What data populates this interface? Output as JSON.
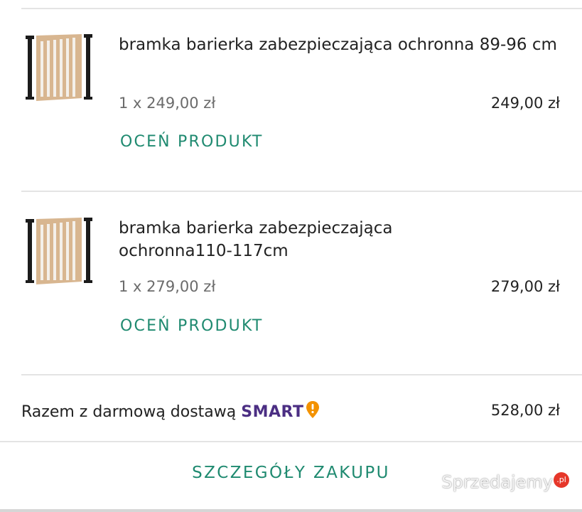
{
  "items": [
    {
      "title": "bramka barierka zabezpieczająca ochronna 89-96 cm",
      "quantity_price": "1 x 249,00 zł",
      "total": "249,00 zł",
      "rate_label": "OCEŃ PRODUKT",
      "image_icon": "baby-gate-image"
    },
    {
      "title": "bramka barierka zabezpieczająca ochronna110-117cm",
      "quantity_price": "1 x 279,00 zł",
      "total": "279,00 zł",
      "rate_label": "OCEŃ PRODUKT",
      "image_icon": "baby-gate-image"
    }
  ],
  "summary": {
    "label": "Razem z darmową dostawą",
    "smart_brand": "SMART",
    "smart_icon": "smart-exclamation-icon",
    "total": "528,00 zł"
  },
  "details_button": "SZCZEGÓŁY ZAKUPU",
  "watermark": {
    "text": "Sprzedajemy",
    "suffix": ".pl"
  },
  "colors": {
    "accent_green": "#1f8a70",
    "smart_purple": "#4b2e83",
    "smart_orange": "#f39200",
    "watermark_red": "#e6372a"
  }
}
